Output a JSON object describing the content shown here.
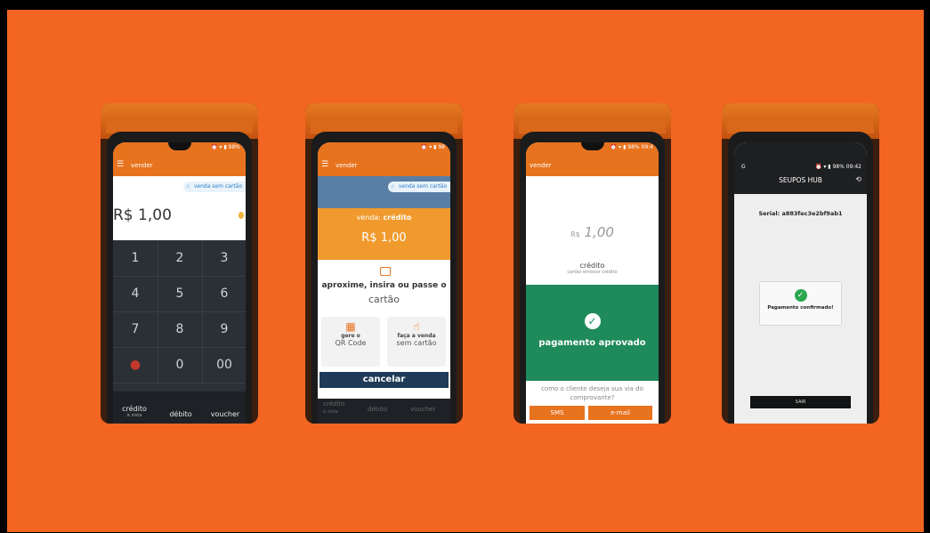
{
  "phone1": {
    "header": "vender",
    "venda_sem_cartao": "venda sem cartão",
    "amount": "R$ 1,00",
    "keys": [
      "1",
      "2",
      "3",
      "4",
      "5",
      "6",
      "7",
      "8",
      "9",
      "0",
      "00"
    ],
    "tabs": [
      {
        "label": "crédito",
        "sub": "à vista"
      },
      {
        "label": "débito",
        "sub": ""
      },
      {
        "label": "voucher",
        "sub": ""
      }
    ],
    "status": "⏰ ▾ ▮ 98%"
  },
  "phone2": {
    "header": "vender",
    "venda_sem_cartao": "venda sem cartão",
    "venda_label": "venda:",
    "venda_tipo": "crédito",
    "amount": "R$ 1,00",
    "instruction_bold": "aproxime, insira ou passe o",
    "instruction_light": "cartão",
    "option_qr_a": "gere o",
    "option_qr_b": "QR Code",
    "option_sem_a": "faça a venda",
    "option_sem_b": "sem cartão",
    "cancel": "cancelar",
    "ghost_tabs": [
      "crédito",
      "débito",
      "voucher"
    ],
    "ghost_sub": "à vista",
    "status": "⏰ ▾ ▮ 98"
  },
  "phone3": {
    "header": "vender",
    "currency": "R$",
    "amount": "1,00",
    "credit": "crédito",
    "credit_sub": "cartão emissor crédito",
    "approved": "pagamento aprovado",
    "question": "como o cliente deseja sua via do comprovante?",
    "btn_sms": "SMS",
    "btn_email": "e-mail",
    "status": "⏰ ▾ ▮ 98% 09:4"
  },
  "phone4": {
    "status": "⏰ ▾ ▮ 98% 09:42",
    "status_left": "G",
    "title": "SEUPOS HUB",
    "serial": "Serial: a883fec3e2bf9ab1",
    "confirmed": "Pagamento confirmado!",
    "exit": "SAIR"
  },
  "colors": {
    "background": "#f26522",
    "accent_orange": "#e8731e",
    "approved_green": "#1f8a5a",
    "navy": "#1f3b57"
  }
}
